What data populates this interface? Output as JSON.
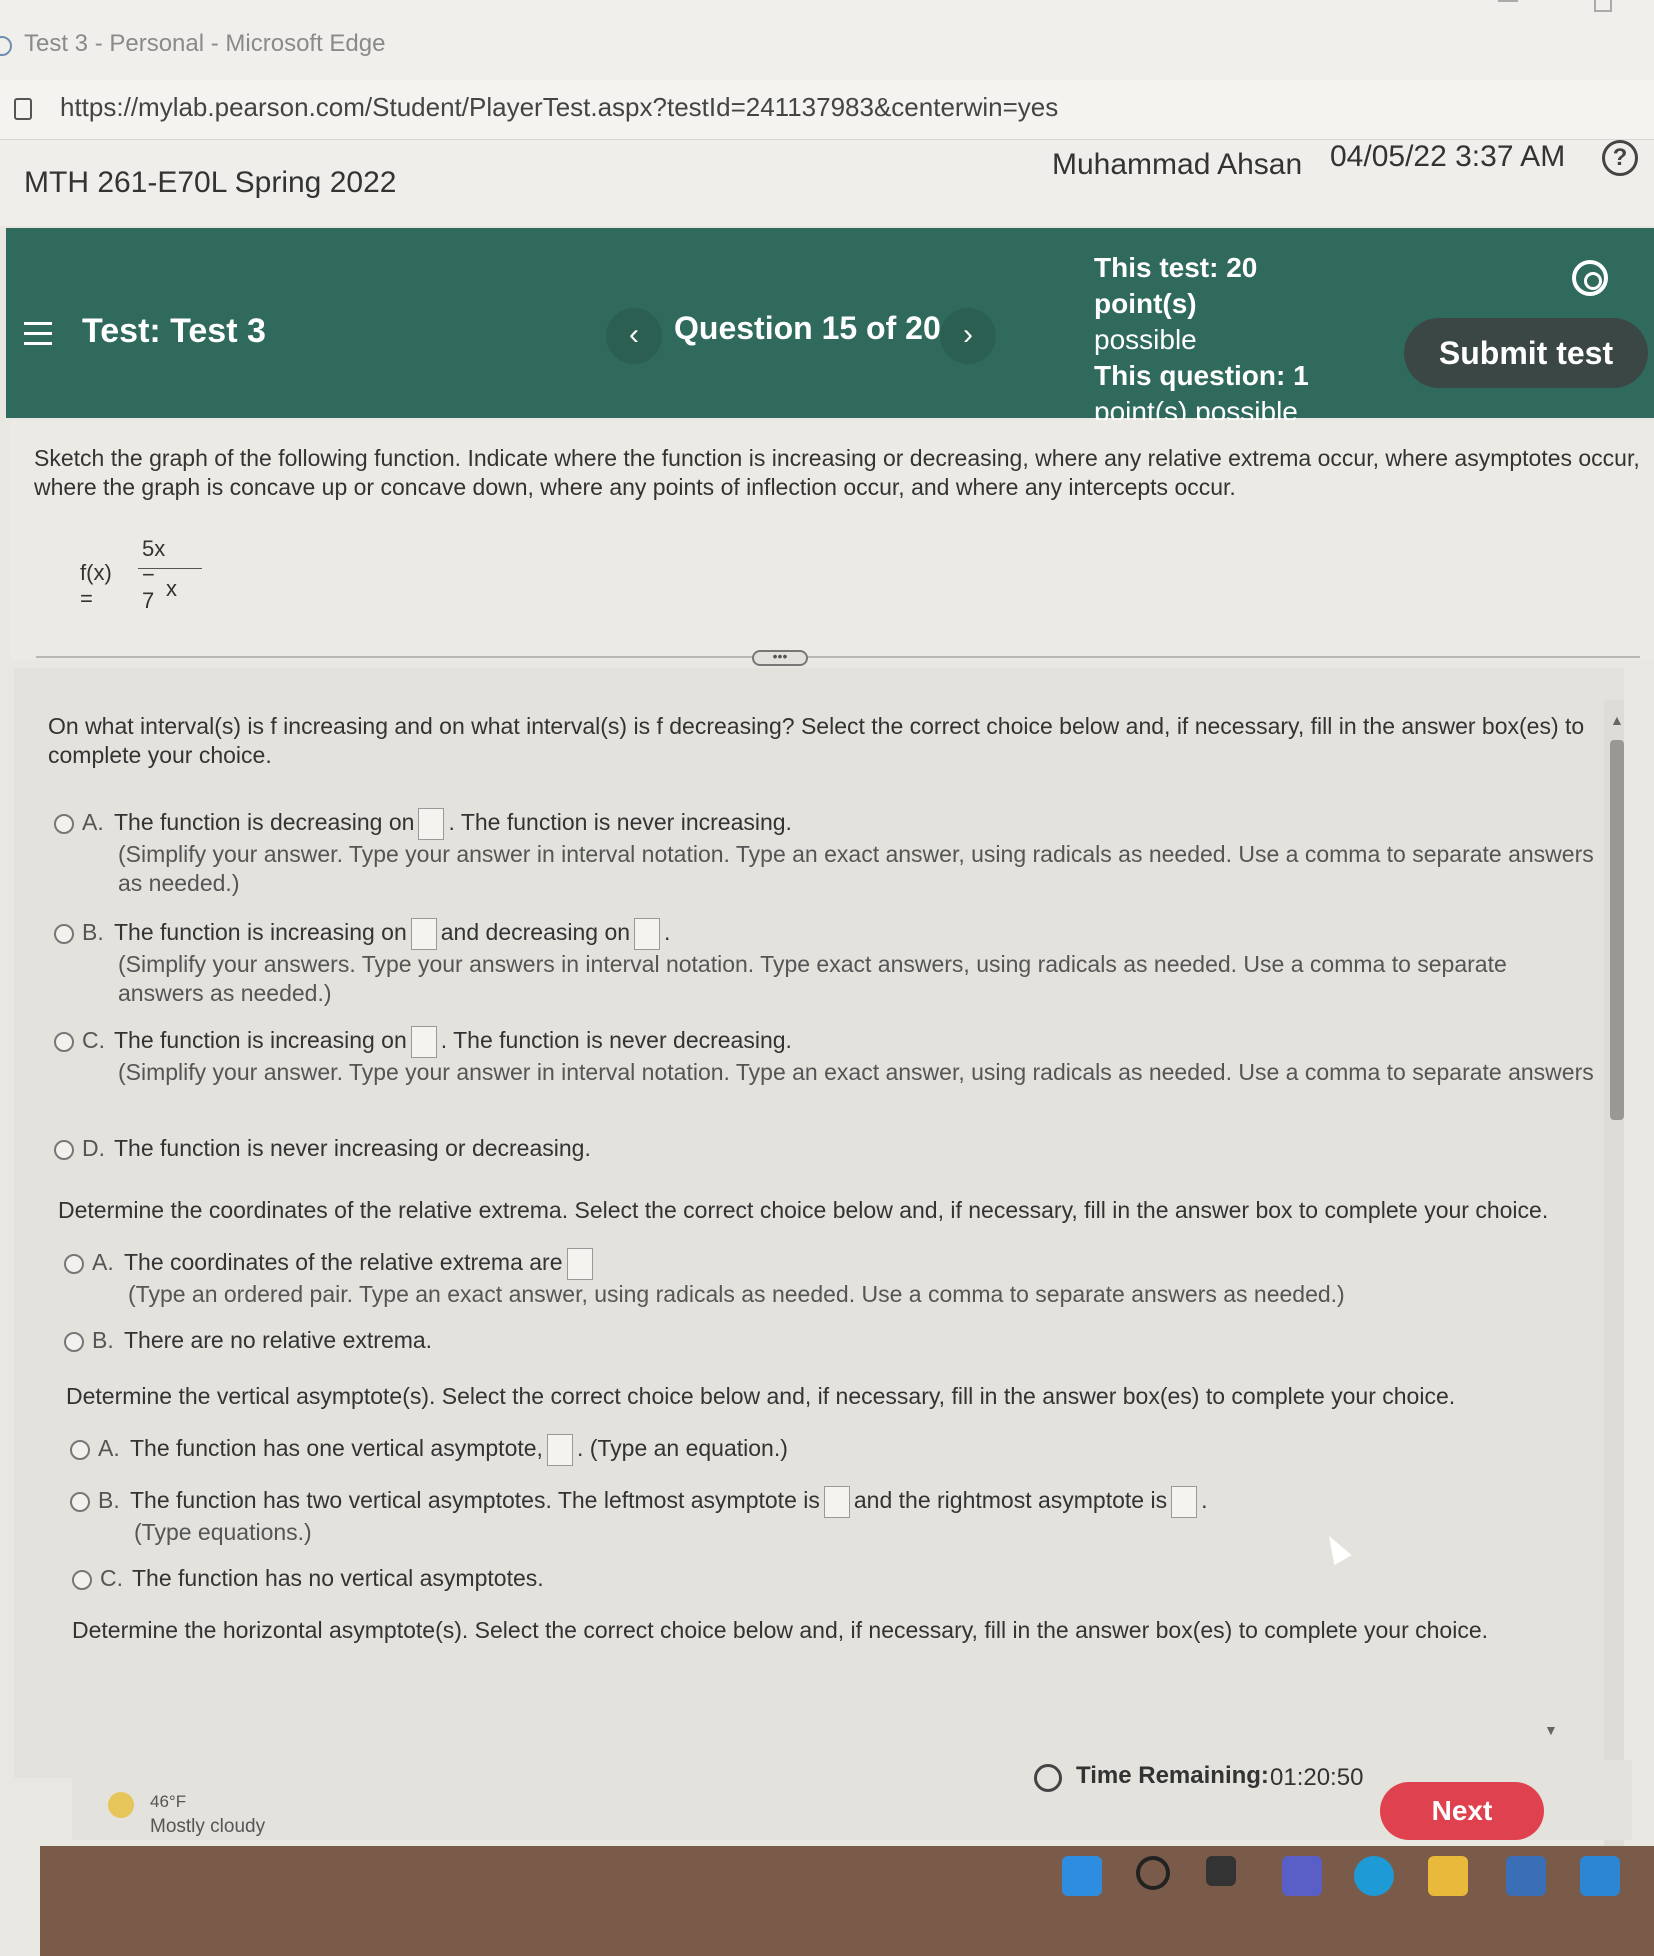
{
  "browser": {
    "window_title": "Test 3 - Personal - Microsoft Edge",
    "url": "https://mylab.pearson.com/Student/PlayerTest.aspx?testId=241137983&centerwin=yes"
  },
  "header": {
    "course": "MTH 261-E70L Spring 2022",
    "user": "Muhammad Ahsan",
    "datetime": "04/05/22 3:37 AM",
    "help_label": "?"
  },
  "testbar": {
    "test_label": "Test:  Test 3",
    "prev_label": "‹",
    "question_counter": "Question 15 of 20",
    "next_label": "›",
    "test_points_line1": "This test: 20 point(s)",
    "test_points_line2": "possible",
    "question_points_line1": "This question: 1",
    "question_points_line2": "point(s) possible",
    "submit_label": "Submit test"
  },
  "question": {
    "stem": "Sketch the graph of the following function. Indicate where the function is increasing or decreasing, where any relative extrema occur, where asymptotes occur, where the graph is concave up or concave down, where any points of inflection occur, and where any intercepts occur.",
    "function_label": "f(x) =",
    "numerator": "5x − 7",
    "denominator": "x",
    "handle": "•••"
  },
  "parts": {
    "p1": {
      "prompt": "On what interval(s) is f increasing and on what interval(s) is f decreasing? Select the correct choice below and, if necessary, fill in the answer box(es) to complete your choice.",
      "a_letter": "A.",
      "a_text1": "The function is decreasing on",
      "a_text2": ". The function is never increasing.",
      "a_hint": "(Simplify your answer. Type your answer in interval notation. Type an exact answer, using radicals as needed. Use a comma to separate answers as needed.)",
      "b_letter": "B.",
      "b_text1": "The function is increasing on",
      "b_text2": "and decreasing on",
      "b_text3": ".",
      "b_hint": "(Simplify your answers. Type your answers in interval notation. Type exact answers, using radicals as needed. Use a comma to separate answers as needed.)",
      "c_letter": "C.",
      "c_text1": "The function is increasing on",
      "c_text2": ". The function is never decreasing.",
      "c_hint": "(Simplify your answer. Type your answer in interval notation. Type an exact answer, using radicals as needed. Use a comma to separate answers",
      "d_letter": "D.",
      "d_text": "The function is never increasing or decreasing."
    },
    "p2": {
      "prompt": "Determine the coordinates of the relative extrema. Select the correct choice below and, if necessary, fill in the answer box to complete your choice.",
      "a_letter": "A.",
      "a_text": "The coordinates of the relative extrema are",
      "a_hint": "(Type an ordered pair. Type an exact answer, using radicals as needed. Use a comma to separate answers as needed.)",
      "b_letter": "B.",
      "b_text": "There are no relative extrema."
    },
    "p3": {
      "prompt": "Determine the vertical asymptote(s). Select the correct choice below and, if necessary, fill in the answer box(es) to complete your choice.",
      "a_letter": "A.",
      "a_text1": "The function has one vertical asymptote,",
      "a_text2": ". (Type an equation.)",
      "b_letter": "B.",
      "b_text1": "The function has two vertical asymptotes. The leftmost asymptote is",
      "b_text2": "and the rightmost asymptote is",
      "b_text3": ".",
      "b_hint": "(Type equations.)",
      "c_letter": "C.",
      "c_text": "The function has no vertical asymptotes."
    },
    "p4": {
      "prompt": "Determine the horizontal asymptote(s). Select the correct choice below and, if necessary, fill in the answer box(es) to complete your choice."
    }
  },
  "footer": {
    "time_label": "Time Remaining:",
    "time_value": "01:20:50",
    "next_label": "Next"
  },
  "taskbar": {
    "weather_temp": "46°F",
    "weather_desc": "Mostly cloudy"
  }
}
